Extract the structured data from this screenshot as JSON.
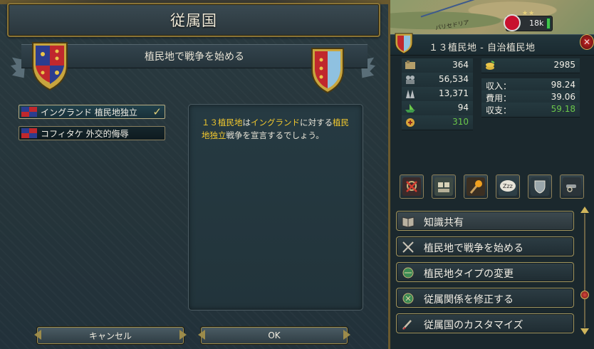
{
  "dialog": {
    "title": "従属国",
    "subheader": "植民地で戦争を始める",
    "options": [
      {
        "label": "イングランド 植民地独立",
        "selected": true
      },
      {
        "label": "コフィタケ 外交的侮辱",
        "selected": false
      }
    ],
    "description": {
      "part1": "１３植民地",
      "part2": "は",
      "part3": "イングランド",
      "part4": "に対する",
      "part5": "植民地独立",
      "part6": "戦争を宣言するでしょう。"
    },
    "cancel_label": "キャンセル",
    "ok_label": "OK"
  },
  "map": {
    "place_text": "パリセドリア",
    "army_size": "18k"
  },
  "panel": {
    "country_name": "１３植民地 - 自治植民地",
    "stats_left": [
      {
        "icon": "development-icon",
        "value": "364"
      },
      {
        "icon": "manpower-icon",
        "value": "56,534"
      },
      {
        "icon": "army-icon",
        "value": "13,371"
      },
      {
        "icon": "navy-icon",
        "value": "94"
      },
      {
        "icon": "liberty-icon",
        "value": "310"
      }
    ],
    "treasury": "2985",
    "income_label": "収入：",
    "income_value": "98.24",
    "expense_label": "費用：",
    "expense_value": "39.06",
    "balance_label": "収支：",
    "balance_value": "59.18",
    "action_buttons": [
      {
        "label": "知識共有"
      },
      {
        "label": "植民地で戦争を始める"
      },
      {
        "label": "植民地タイプの変更"
      },
      {
        "label": "従属関係を修正する"
      },
      {
        "label": "従属国のカスタマイズ"
      }
    ]
  },
  "colors": {
    "accent_gold": "#f2c82e",
    "positive_green": "#6bc74a"
  }
}
